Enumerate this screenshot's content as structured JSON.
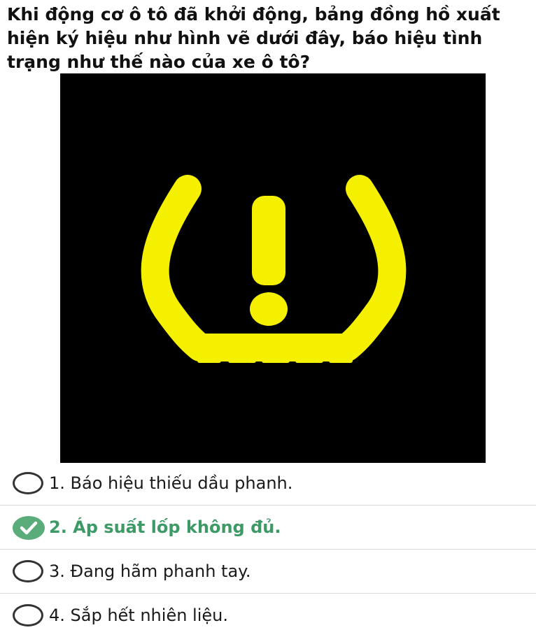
{
  "question": {
    "text": "Khi động cơ ô tô đã khởi động, bảng đồng hồ xuất hiện ký hiệu như hình vẽ dưới đây, báo hiệu tình trạng như thế nào của xe ô tô?"
  },
  "sign": {
    "icon": "tire-pressure-warning-icon",
    "background_color": "#000000",
    "symbol_color": "#f5f000"
  },
  "options": [
    {
      "label": "1. Báo hiệu thiếu dầu phanh.",
      "state": "unselected"
    },
    {
      "label": "2. Áp suất lốp không đủ.",
      "state": "correct"
    },
    {
      "label": "3. Đang hãm phanh tay.",
      "state": "unselected"
    },
    {
      "label": "4. Sắp hết nhiên liệu.",
      "state": "unselected"
    }
  ],
  "colors": {
    "correct": "#3d9a66",
    "correct_badge": "#5aad7a"
  }
}
